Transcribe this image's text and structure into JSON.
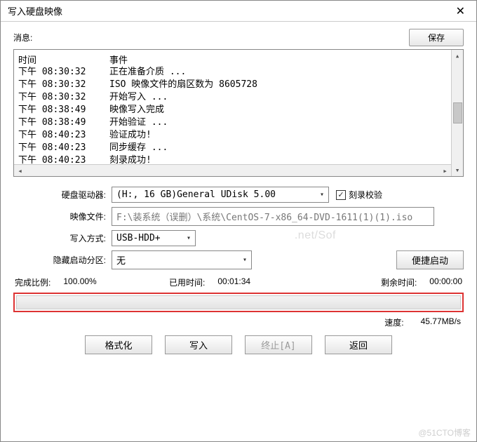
{
  "title": "写入硬盘映像",
  "msg_label": "消息:",
  "save_label": "保存",
  "log_headers": {
    "time": "时间",
    "event": "事件"
  },
  "log": [
    {
      "time": "下午 08:30:32",
      "event": "正在准备介质 ..."
    },
    {
      "time": "下午 08:30:32",
      "event": "ISO 映像文件的扇区数为 8605728"
    },
    {
      "time": "下午 08:30:32",
      "event": "开始写入 ..."
    },
    {
      "time": "下午 08:38:49",
      "event": "映像写入完成"
    },
    {
      "time": "下午 08:38:49",
      "event": "开始验证 ..."
    },
    {
      "time": "下午 08:40:23",
      "event": "验证成功!"
    },
    {
      "time": "下午 08:40:23",
      "event": "同步缓存 ..."
    },
    {
      "time": "下午 08:40:23",
      "event": "刻录成功!"
    }
  ],
  "form": {
    "drive_label": "硬盘驱动器:",
    "drive_value": "(H:, 16 GB)General UDisk        5.00",
    "verify_check": "刻录校验",
    "verify_checked": true,
    "image_label": "映像文件:",
    "image_value": "F:\\装系统（误删）\\系统\\CentOS-7-x86_64-DVD-1611(1)(1).iso",
    "write_mode_label": "写入方式:",
    "write_mode_value": "USB-HDD+",
    "hide_boot_label": "隐藏启动分区:",
    "hide_boot_value": "无",
    "quick_boot_btn": "便捷启动"
  },
  "stats": {
    "done_label": "完成比例:",
    "done_value": "100.00%",
    "elapsed_label": "已用时间:",
    "elapsed_value": "00:01:34",
    "remain_label": "剩余时间:",
    "remain_value": "00:00:00",
    "speed_label": "速度:",
    "speed_value": "45.77MB/s"
  },
  "buttons": {
    "format": "格式化",
    "write": "写入",
    "abort": "终止[A]",
    "back": "返回"
  },
  "watermark": "@51CTO博客",
  "bg_watermark": ".net/Sof"
}
